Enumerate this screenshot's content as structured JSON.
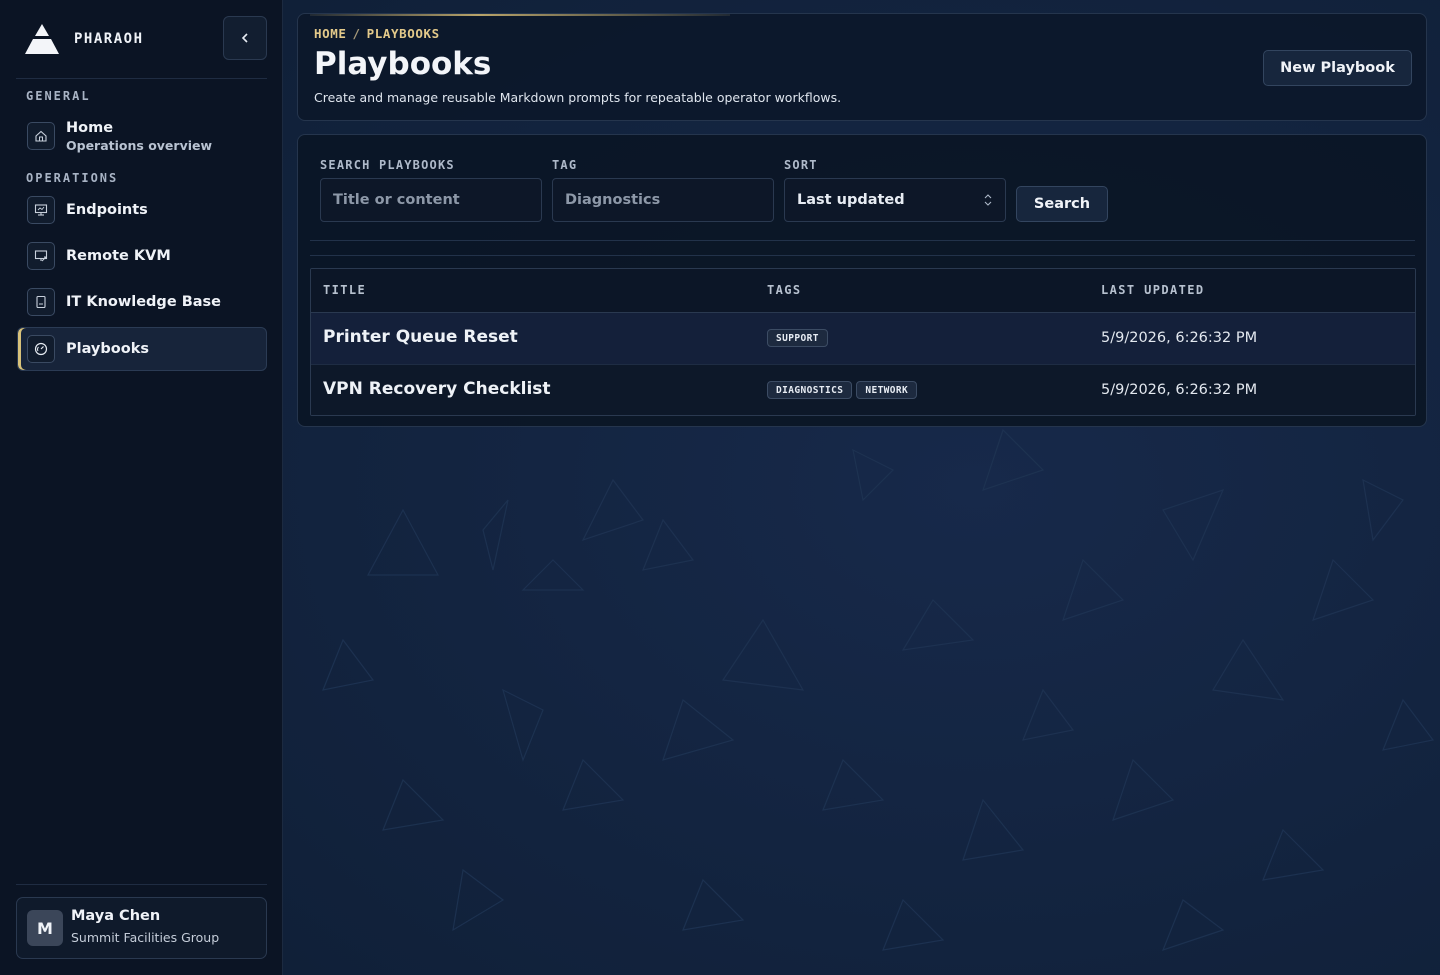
{
  "brand": {
    "name": "PHARAOH",
    "collapse_icon": "chevron-left-icon"
  },
  "sidebar": {
    "sections": [
      {
        "label": "GENERAL"
      },
      {
        "label": "OPERATIONS"
      }
    ],
    "items": [
      {
        "label": "Home",
        "sub": "Operations overview",
        "icon": "home-icon"
      },
      {
        "label": "Endpoints",
        "icon": "monitor-icon"
      },
      {
        "label": "Remote KVM",
        "icon": "remote-screen-icon"
      },
      {
        "label": "IT Knowledge Base",
        "icon": "book-icon"
      },
      {
        "label": "Playbooks",
        "icon": "gauge-icon",
        "active": true
      }
    ],
    "user": {
      "initial": "M",
      "name": "Maya Chen",
      "org": "Summit Facilities Group"
    }
  },
  "header": {
    "breadcrumb": [
      "HOME",
      "/",
      "PLAYBOOKS"
    ],
    "title": "Playbooks",
    "description": "Create and manage reusable Markdown prompts for repeatable operator workflows.",
    "new_button": "New Playbook"
  },
  "filters": {
    "search": {
      "label": "SEARCH PLAYBOOKS",
      "placeholder": "Title or content"
    },
    "tag": {
      "label": "TAG",
      "value": "Diagnostics"
    },
    "sort": {
      "label": "SORT",
      "value": "Last updated"
    },
    "search_button": "Search"
  },
  "table": {
    "columns": [
      "TITLE",
      "TAGS",
      "LAST UPDATED"
    ],
    "rows": [
      {
        "title": "Printer Queue Reset",
        "tags": [
          "SUPPORT"
        ],
        "updated": "5/9/2026, 6:26:32 PM"
      },
      {
        "title": "VPN Recovery Checklist",
        "tags": [
          "DIAGNOSTICS",
          "NETWORK"
        ],
        "updated": "5/9/2026, 6:26:32 PM"
      }
    ]
  },
  "colors": {
    "accent": "#e3c98a",
    "background": "#13243d",
    "sidebar": "#0b1424"
  }
}
